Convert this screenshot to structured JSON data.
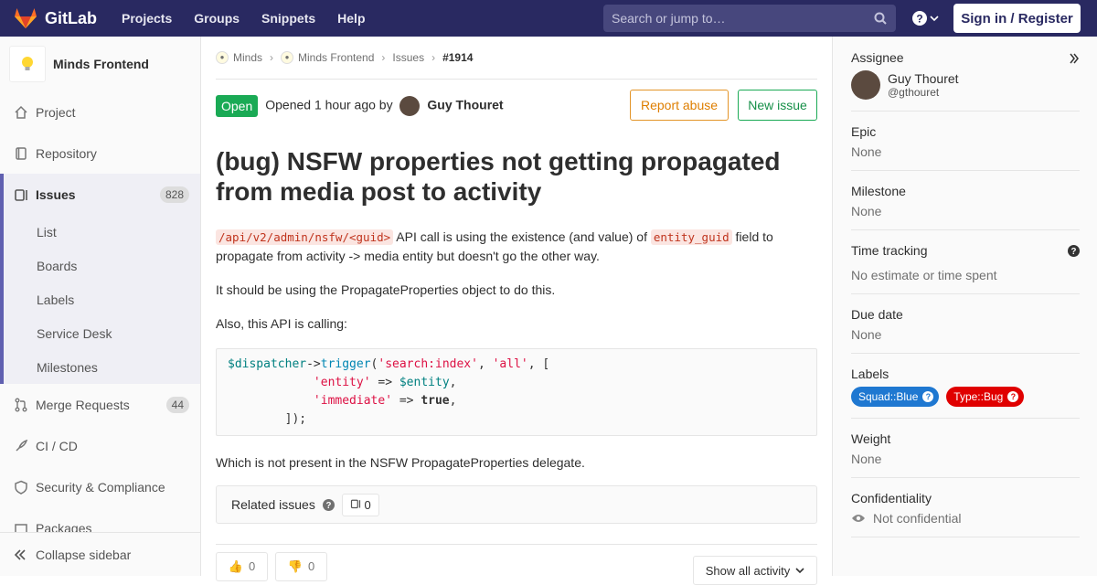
{
  "topbar": {
    "brand": "GitLab",
    "nav": [
      "Projects",
      "Groups",
      "Snippets",
      "Help"
    ],
    "search_placeholder": "Search or jump to…",
    "signin_label": "Sign in / Register"
  },
  "sidebar": {
    "project_name": "Minds Frontend",
    "items": [
      {
        "label": "Project",
        "icon": "home-icon"
      },
      {
        "label": "Repository",
        "icon": "repository-icon"
      },
      {
        "label": "Issues",
        "icon": "issues-icon",
        "count": "828"
      },
      {
        "label": "Merge Requests",
        "icon": "merge-request-icon",
        "count": "44"
      },
      {
        "label": "CI / CD",
        "icon": "rocket-icon"
      },
      {
        "label": "Security & Compliance",
        "icon": "shield-icon"
      },
      {
        "label": "Packages",
        "icon": "package-icon"
      }
    ],
    "sub_items": [
      "List",
      "Boards",
      "Labels",
      "Service Desk",
      "Milestones"
    ],
    "collapse_label": "Collapse sidebar"
  },
  "breadcrumb": [
    "Minds",
    "Minds Frontend",
    "Issues",
    "#1914"
  ],
  "issue": {
    "status": "Open",
    "opened_text": "Opened 1 hour ago by",
    "author": "Guy Thouret",
    "report_label": "Report abuse",
    "new_issue_label": "New issue",
    "title": "(bug) NSFW properties not getting propagated from media post to activity",
    "para1_code1": "/api/v2/admin/nsfw/<guid>",
    "para1_text1": " API call is using the existence (and value) of ",
    "para1_code2": "entity_guid",
    "para1_text2": " field to propagate from activity -> media entity but doesn't go the other way.",
    "para2": "It should be using the PropagateProperties object to do this.",
    "para3": "Also, this API is calling:",
    "para4": "Which is not present in the NSFW PropagateProperties delegate.",
    "related_label": "Related issues",
    "related_count": "0",
    "thumbs_up": "0",
    "thumbs_down": "0",
    "activity_label": "Show all activity"
  },
  "right": {
    "assignee_label": "Assignee",
    "assignee_name": "Guy Thouret",
    "assignee_handle": "@gthouret",
    "epic_label": "Epic",
    "epic_value": "None",
    "milestone_label": "Milestone",
    "milestone_value": "None",
    "time_label": "Time tracking",
    "time_value": "No estimate or time spent",
    "due_label": "Due date",
    "due_value": "None",
    "labels_label": "Labels",
    "labels": [
      {
        "text": "Squad::Blue",
        "color": "#1f78d1"
      },
      {
        "text": "Type::Bug",
        "color": "#e00000"
      }
    ],
    "weight_label": "Weight",
    "weight_value": "None",
    "conf_label": "Confidentiality",
    "conf_value": "Not confidential"
  }
}
